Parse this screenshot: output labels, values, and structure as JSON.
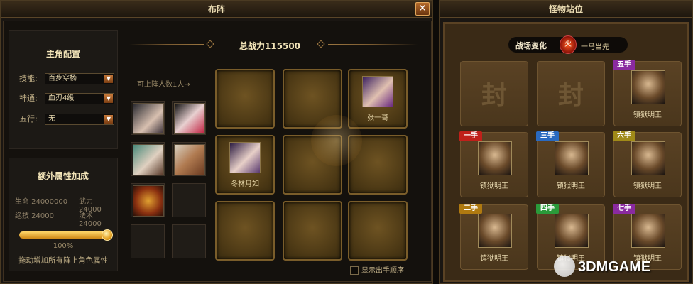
{
  "left_window": {
    "title": "布阵",
    "close_label": "✕",
    "power_label": "总战力115500",
    "deploy_hint": "可上阵人数1人→",
    "config": {
      "title": "主角配置",
      "rows": [
        {
          "label": "技能:",
          "value": "百步穿杨"
        },
        {
          "label": "神通:",
          "value": "血刃4级"
        },
        {
          "label": "五行:",
          "value": "无"
        }
      ]
    },
    "attr": {
      "title": "额外属性加成",
      "line1_left": "生命 24000000",
      "line1_right": "武力 24000",
      "line2_left": "绝技 24000",
      "line2_right": "法术 24000",
      "percent": "100%",
      "percent_value": 1.0,
      "hint": "拖动增加所有阵上角色属性"
    },
    "grid": [
      {
        "name": ""
      },
      {
        "name": ""
      },
      {
        "name": "张一哥"
      },
      {
        "name": "冬林月如"
      },
      {
        "name": ""
      },
      {
        "name": ""
      },
      {
        "name": ""
      },
      {
        "name": ""
      },
      {
        "name": ""
      }
    ],
    "show_order_label": "显示出手顺序"
  },
  "right_window": {
    "title": "怪物站位",
    "battle_change_label": "战场变化",
    "battle_change_icon": "火",
    "battle_change_name": "一马当先",
    "seal_char": "封",
    "monsters": [
      {
        "tag": "五手",
        "name": "镇狱明王",
        "tag_color": "#8a2aa0"
      },
      {
        "tag": "一手",
        "name": "镇狱明王",
        "tag_color": "#c0201a"
      },
      {
        "tag": "三手",
        "name": "镇狱明王",
        "tag_color": "#2a6ac0"
      },
      {
        "tag": "六手",
        "name": "镇狱明王",
        "tag_color": "#a08a18"
      },
      {
        "tag": "二手",
        "name": "镇狱明王",
        "tag_color": "#b07a10"
      },
      {
        "tag": "四手",
        "name": "镇狱明王",
        "tag_color": "#2a9a3a"
      },
      {
        "tag": "七手",
        "name": "镇狱明王",
        "tag_color": "#8a2aa0"
      }
    ]
  },
  "watermark": "3DMGAME",
  "colors": {
    "gold": "#d08a18",
    "panel_bg": "#1c1915",
    "grid_cell": "#4a3714"
  }
}
